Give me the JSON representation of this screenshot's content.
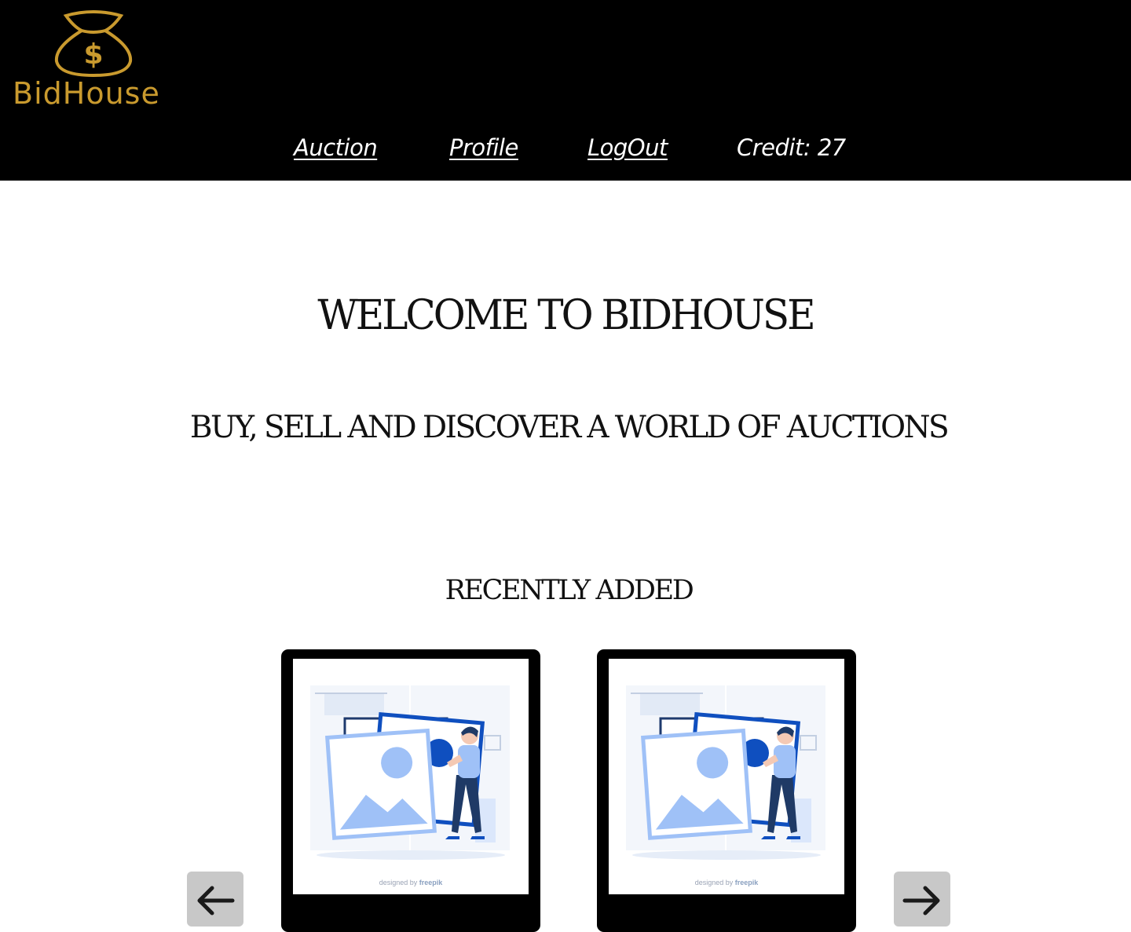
{
  "header": {
    "logo_text": "BidHouse",
    "logo_icon": "money-bag-icon",
    "brand_color": "#c99a2e",
    "background": "#000000"
  },
  "nav": {
    "auction": "Auction",
    "profile": "Profile",
    "logout": "LogOut",
    "credit": "Credit: 27"
  },
  "hero": {
    "title": "WELCOME TO BIDHOUSE",
    "subtitle": "BUY, SELL AND DISCOVER A WORLD OF AUCTIONS"
  },
  "recent": {
    "title": "RECENTLY ADDED",
    "cards": [
      {
        "image_credit_prefix": "designed by",
        "image_credit_brand": "freepik"
      },
      {
        "image_credit_prefix": "designed by",
        "image_credit_brand": "freepik"
      }
    ],
    "prev_icon": "arrow-left-icon",
    "next_icon": "arrow-right-icon"
  }
}
